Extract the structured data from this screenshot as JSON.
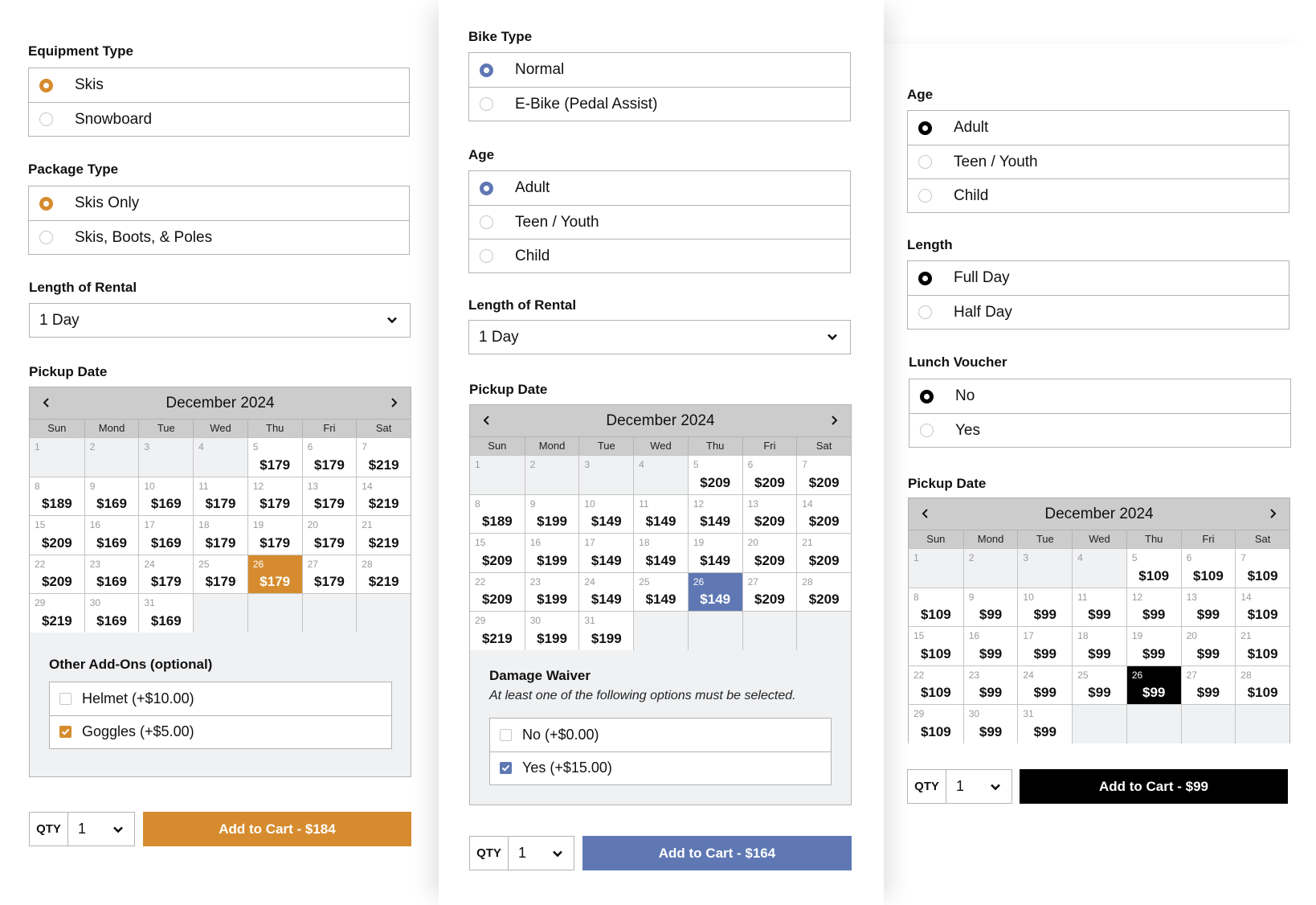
{
  "weekdays": [
    "Sun",
    "Mond",
    "Tue",
    "Wed",
    "Thu",
    "Fri",
    "Sat"
  ],
  "ski": {
    "accent": "#d68c2e",
    "equipment": {
      "label": "Equipment Type",
      "options": [
        {
          "label": "Skis",
          "selected": true
        },
        {
          "label": "Snowboard",
          "selected": false
        }
      ]
    },
    "package": {
      "label": "Package Type",
      "options": [
        {
          "label": "Skis Only",
          "selected": true
        },
        {
          "label": "Skis, Boots, & Poles",
          "selected": false
        }
      ]
    },
    "length": {
      "label": "Length of Rental",
      "value": "1 Day"
    },
    "pickup": {
      "label": "Pickup Date",
      "month": "December 2024",
      "selected_day": 26,
      "disabled_days": [
        1,
        2,
        3,
        4
      ],
      "prices": {
        "5": "$179",
        "6": "$179",
        "7": "$219",
        "8": "$189",
        "9": "$169",
        "10": "$169",
        "11": "$179",
        "12": "$179",
        "13": "$179",
        "14": "$219",
        "15": "$209",
        "16": "$169",
        "17": "$169",
        "18": "$179",
        "19": "$179",
        "20": "$179",
        "21": "$219",
        "22": "$209",
        "23": "$169",
        "24": "$179",
        "25": "$179",
        "26": "$179",
        "27": "$179",
        "28": "$219",
        "29": "$219",
        "30": "$169",
        "31": "$169"
      }
    },
    "addons": {
      "title": "Other Add-Ons (optional)",
      "options": [
        {
          "label": "Helmet (+$10.00)",
          "checked": false
        },
        {
          "label": "Goggles (+$5.00)",
          "checked": true
        }
      ]
    },
    "qty": {
      "label": "QTY",
      "value": "1"
    },
    "cart_label": "Add to Cart - $184"
  },
  "bike": {
    "accent": "#5f78b4",
    "bike_type": {
      "label": "Bike Type",
      "options": [
        {
          "label": "Normal",
          "selected": true
        },
        {
          "label": "E-Bike (Pedal Assist)",
          "selected": false
        }
      ]
    },
    "age": {
      "label": "Age",
      "options": [
        {
          "label": "Adult",
          "selected": true
        },
        {
          "label": "Teen / Youth",
          "selected": false
        },
        {
          "label": "Child",
          "selected": false
        }
      ]
    },
    "length": {
      "label": "Length of Rental",
      "value": "1 Day"
    },
    "pickup": {
      "label": "Pickup Date",
      "month": "December 2024",
      "selected_day": 26,
      "disabled_days": [
        1,
        2,
        3,
        4
      ],
      "prices": {
        "5": "$209",
        "6": "$209",
        "7": "$209",
        "8": "$189",
        "9": "$199",
        "10": "$149",
        "11": "$149",
        "12": "$149",
        "13": "$209",
        "14": "$209",
        "15": "$209",
        "16": "$199",
        "17": "$149",
        "18": "$149",
        "19": "$149",
        "20": "$209",
        "21": "$209",
        "22": "$209",
        "23": "$199",
        "24": "$149",
        "25": "$149",
        "26": "$149",
        "27": "$209",
        "28": "$209",
        "29": "$219",
        "30": "$199",
        "31": "$199"
      }
    },
    "waiver": {
      "title": "Damage Waiver",
      "note": "At least one of the following options must be selected.",
      "options": [
        {
          "label": "No (+$0.00)",
          "checked": false
        },
        {
          "label": "Yes (+$15.00)",
          "checked": true
        }
      ]
    },
    "qty": {
      "label": "QTY",
      "value": "1"
    },
    "cart_label": "Add to Cart - $164"
  },
  "general": {
    "accent": "#000000",
    "age": {
      "label": "Age",
      "options": [
        {
          "label": "Adult",
          "selected": true
        },
        {
          "label": "Teen / Youth",
          "selected": false
        },
        {
          "label": "Child",
          "selected": false
        }
      ]
    },
    "length": {
      "label": "Length",
      "options": [
        {
          "label": "Full Day",
          "selected": true
        },
        {
          "label": "Half Day",
          "selected": false
        }
      ]
    },
    "lunch": {
      "label": "Lunch Voucher",
      "options": [
        {
          "label": "No",
          "selected": true
        },
        {
          "label": "Yes",
          "selected": false
        }
      ]
    },
    "pickup": {
      "label": "Pickup Date",
      "month": "December 2024",
      "selected_day": 26,
      "disabled_days": [
        1,
        2,
        3,
        4
      ],
      "prices": {
        "5": "$109",
        "6": "$109",
        "7": "$109",
        "8": "$109",
        "9": "$99",
        "10": "$99",
        "11": "$99",
        "12": "$99",
        "13": "$99",
        "14": "$109",
        "15": "$109",
        "16": "$99",
        "17": "$99",
        "18": "$99",
        "19": "$99",
        "20": "$99",
        "21": "$109",
        "22": "$109",
        "23": "$99",
        "24": "$99",
        "25": "$99",
        "26": "$99",
        "27": "$99",
        "28": "$109",
        "29": "$109",
        "30": "$99",
        "31": "$99"
      }
    },
    "qty": {
      "label": "QTY",
      "value": "1"
    },
    "cart_label": "Add to Cart - $99"
  }
}
